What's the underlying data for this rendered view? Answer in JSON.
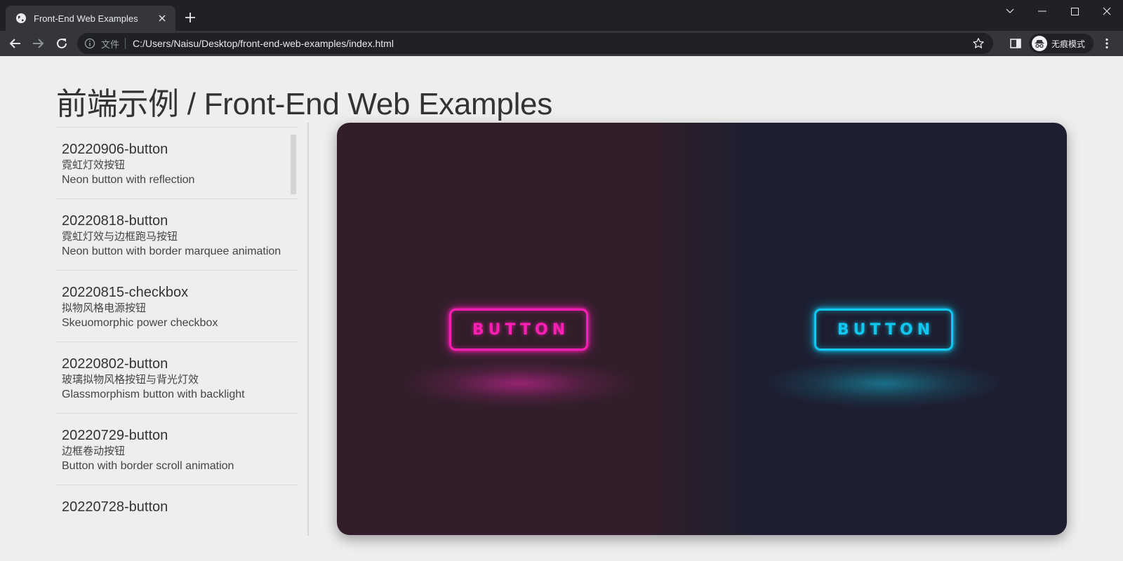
{
  "browser": {
    "tab": {
      "title": "Front-End Web Examples"
    },
    "address_bar": {
      "chip": "文件",
      "url": "C:/Users/Naisu/Desktop/front-end-web-examples/index.html"
    },
    "profile": {
      "label": "无痕模式"
    }
  },
  "page": {
    "title": "前端示例 / Front-End Web Examples",
    "examples": [
      {
        "title": "20220906-button",
        "zh": "霓虹灯效按钮",
        "en": "Neon button with reflection"
      },
      {
        "title": "20220818-button",
        "zh": "霓虹灯效与边框跑马按钮",
        "en": "Neon button with border marquee animation"
      },
      {
        "title": "20220815-checkbox",
        "zh": "拟物风格电源按钮",
        "en": "Skeuomorphic power checkbox"
      },
      {
        "title": "20220802-button",
        "zh": "玻璃拟物风格按钮与背光灯效",
        "en": "Glassmorphism button with backlight"
      },
      {
        "title": "20220729-button",
        "zh": "边框卷动按钮",
        "en": "Button with border scroll animation"
      },
      {
        "title": "20220728-button",
        "zh": "",
        "en": ""
      }
    ]
  },
  "demo": {
    "pink_button": {
      "label": "BUTTON",
      "color": "#ff1eb4"
    },
    "cyan_button": {
      "label": "BUTTON",
      "color": "#10c8ef"
    }
  }
}
